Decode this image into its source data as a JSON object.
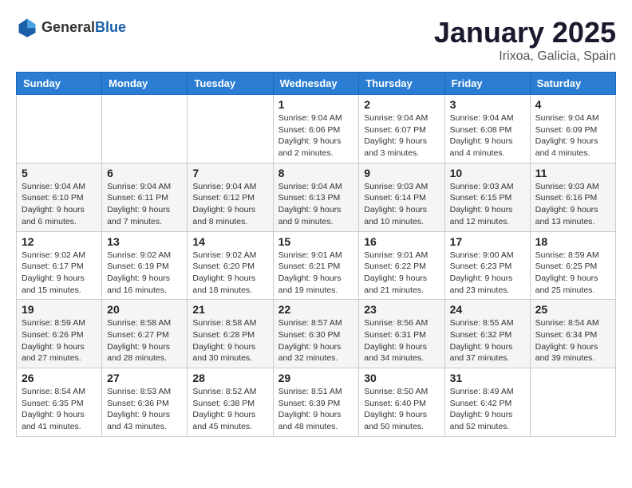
{
  "header": {
    "logo_general": "General",
    "logo_blue": "Blue",
    "month": "January 2025",
    "location": "Irixoa, Galicia, Spain"
  },
  "weekdays": [
    "Sunday",
    "Monday",
    "Tuesday",
    "Wednesday",
    "Thursday",
    "Friday",
    "Saturday"
  ],
  "weeks": [
    {
      "row": 1,
      "days": [
        {
          "num": "",
          "info": ""
        },
        {
          "num": "",
          "info": ""
        },
        {
          "num": "",
          "info": ""
        },
        {
          "num": "1",
          "info": "Sunrise: 9:04 AM\nSunset: 6:06 PM\nDaylight: 9 hours and 2 minutes."
        },
        {
          "num": "2",
          "info": "Sunrise: 9:04 AM\nSunset: 6:07 PM\nDaylight: 9 hours and 3 minutes."
        },
        {
          "num": "3",
          "info": "Sunrise: 9:04 AM\nSunset: 6:08 PM\nDaylight: 9 hours and 4 minutes."
        },
        {
          "num": "4",
          "info": "Sunrise: 9:04 AM\nSunset: 6:09 PM\nDaylight: 9 hours and 4 minutes."
        }
      ]
    },
    {
      "row": 2,
      "days": [
        {
          "num": "5",
          "info": "Sunrise: 9:04 AM\nSunset: 6:10 PM\nDaylight: 9 hours and 6 minutes."
        },
        {
          "num": "6",
          "info": "Sunrise: 9:04 AM\nSunset: 6:11 PM\nDaylight: 9 hours and 7 minutes."
        },
        {
          "num": "7",
          "info": "Sunrise: 9:04 AM\nSunset: 6:12 PM\nDaylight: 9 hours and 8 minutes."
        },
        {
          "num": "8",
          "info": "Sunrise: 9:04 AM\nSunset: 6:13 PM\nDaylight: 9 hours and 9 minutes."
        },
        {
          "num": "9",
          "info": "Sunrise: 9:03 AM\nSunset: 6:14 PM\nDaylight: 9 hours and 10 minutes."
        },
        {
          "num": "10",
          "info": "Sunrise: 9:03 AM\nSunset: 6:15 PM\nDaylight: 9 hours and 12 minutes."
        },
        {
          "num": "11",
          "info": "Sunrise: 9:03 AM\nSunset: 6:16 PM\nDaylight: 9 hours and 13 minutes."
        }
      ]
    },
    {
      "row": 3,
      "days": [
        {
          "num": "12",
          "info": "Sunrise: 9:02 AM\nSunset: 6:17 PM\nDaylight: 9 hours and 15 minutes."
        },
        {
          "num": "13",
          "info": "Sunrise: 9:02 AM\nSunset: 6:19 PM\nDaylight: 9 hours and 16 minutes."
        },
        {
          "num": "14",
          "info": "Sunrise: 9:02 AM\nSunset: 6:20 PM\nDaylight: 9 hours and 18 minutes."
        },
        {
          "num": "15",
          "info": "Sunrise: 9:01 AM\nSunset: 6:21 PM\nDaylight: 9 hours and 19 minutes."
        },
        {
          "num": "16",
          "info": "Sunrise: 9:01 AM\nSunset: 6:22 PM\nDaylight: 9 hours and 21 minutes."
        },
        {
          "num": "17",
          "info": "Sunrise: 9:00 AM\nSunset: 6:23 PM\nDaylight: 9 hours and 23 minutes."
        },
        {
          "num": "18",
          "info": "Sunrise: 8:59 AM\nSunset: 6:25 PM\nDaylight: 9 hours and 25 minutes."
        }
      ]
    },
    {
      "row": 4,
      "days": [
        {
          "num": "19",
          "info": "Sunrise: 8:59 AM\nSunset: 6:26 PM\nDaylight: 9 hours and 27 minutes."
        },
        {
          "num": "20",
          "info": "Sunrise: 8:58 AM\nSunset: 6:27 PM\nDaylight: 9 hours and 28 minutes."
        },
        {
          "num": "21",
          "info": "Sunrise: 8:58 AM\nSunset: 6:28 PM\nDaylight: 9 hours and 30 minutes."
        },
        {
          "num": "22",
          "info": "Sunrise: 8:57 AM\nSunset: 6:30 PM\nDaylight: 9 hours and 32 minutes."
        },
        {
          "num": "23",
          "info": "Sunrise: 8:56 AM\nSunset: 6:31 PM\nDaylight: 9 hours and 34 minutes."
        },
        {
          "num": "24",
          "info": "Sunrise: 8:55 AM\nSunset: 6:32 PM\nDaylight: 9 hours and 37 minutes."
        },
        {
          "num": "25",
          "info": "Sunrise: 8:54 AM\nSunset: 6:34 PM\nDaylight: 9 hours and 39 minutes."
        }
      ]
    },
    {
      "row": 5,
      "days": [
        {
          "num": "26",
          "info": "Sunrise: 8:54 AM\nSunset: 6:35 PM\nDaylight: 9 hours and 41 minutes."
        },
        {
          "num": "27",
          "info": "Sunrise: 8:53 AM\nSunset: 6:36 PM\nDaylight: 9 hours and 43 minutes."
        },
        {
          "num": "28",
          "info": "Sunrise: 8:52 AM\nSunset: 6:38 PM\nDaylight: 9 hours and 45 minutes."
        },
        {
          "num": "29",
          "info": "Sunrise: 8:51 AM\nSunset: 6:39 PM\nDaylight: 9 hours and 48 minutes."
        },
        {
          "num": "30",
          "info": "Sunrise: 8:50 AM\nSunset: 6:40 PM\nDaylight: 9 hours and 50 minutes."
        },
        {
          "num": "31",
          "info": "Sunrise: 8:49 AM\nSunset: 6:42 PM\nDaylight: 9 hours and 52 minutes."
        },
        {
          "num": "",
          "info": ""
        }
      ]
    }
  ]
}
